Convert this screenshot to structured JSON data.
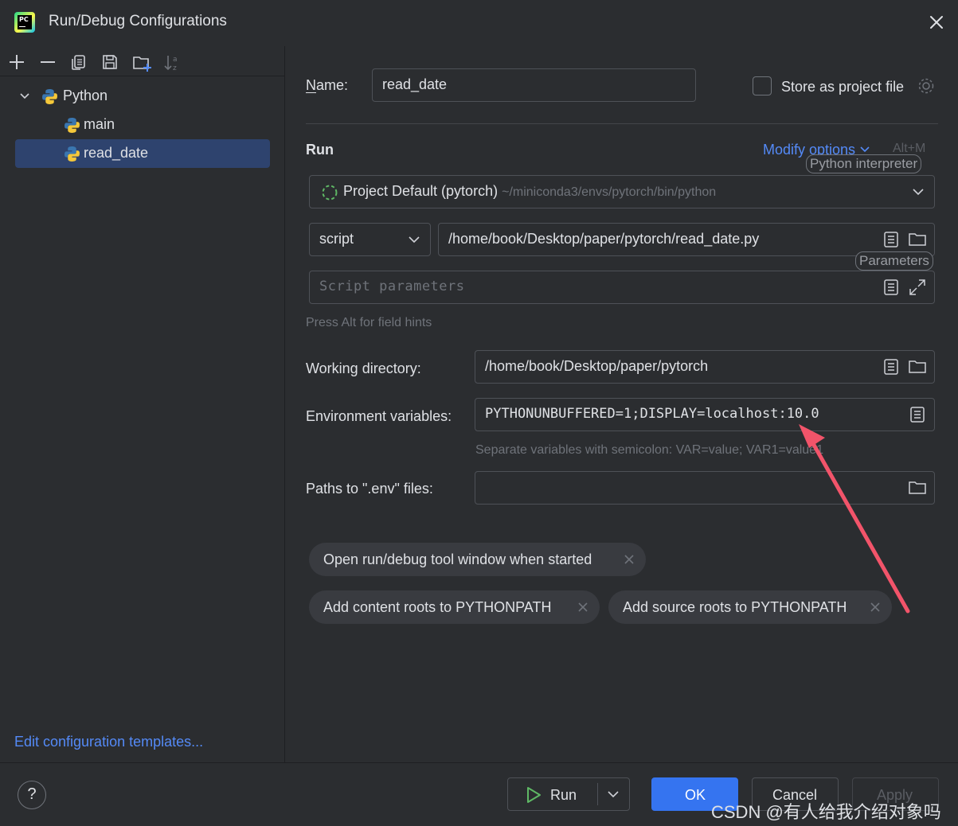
{
  "window": {
    "title": "Run/Debug Configurations"
  },
  "tree": {
    "group": "Python",
    "items": [
      {
        "label": "main"
      },
      {
        "label": "read_date",
        "selected": true
      }
    ]
  },
  "left_footer": {
    "edit_templates": "Edit configuration templates..."
  },
  "form": {
    "name_label": "Name:",
    "name_value": "read_date",
    "store_label": "Store as project file",
    "store_checked": false,
    "run_heading": "Run",
    "modify_options": "Modify options",
    "modify_shortcut": "Alt+M",
    "interpreter_tooltip": "Python interpreter",
    "interpreter_name": "Project Default (pytorch)",
    "interpreter_path": "~/miniconda3/envs/pytorch/bin/python",
    "script_type": "script",
    "script_path": "/home/book/Desktop/paper/pytorch/read_date.py",
    "parameters_tooltip": "Parameters",
    "script_params_placeholder": "Script parameters",
    "field_hints": "Press Alt for field hints",
    "workdir_label": "Working directory:",
    "workdir_value": "/home/book/Desktop/paper/pytorch",
    "env_label": "Environment variables:",
    "env_value": "PYTHONUNBUFFERED=1;DISPLAY=localhost:10.0",
    "env_hint": "Separate variables with semicolon: VAR=value; VAR1=value1",
    "dotenv_label": "Paths to \".env\" files:",
    "dotenv_value": ""
  },
  "chips": [
    {
      "label": "Open run/debug tool window when started"
    },
    {
      "label": "Add content roots to PYTHONPATH"
    },
    {
      "label": "Add source roots to PYTHONPATH"
    }
  ],
  "footer": {
    "help": "?",
    "run": "Run",
    "ok": "OK",
    "cancel": "Cancel",
    "apply": "Apply"
  },
  "watermark": "CSDN @有人给我介绍对象吗",
  "colors": {
    "background": "#2b2d30",
    "selection": "#2e436e",
    "link": "#548af7",
    "primary_button": "#3574f0",
    "annotation_arrow": "#f2546a"
  },
  "icons": {
    "toolbar": [
      "add-icon",
      "remove-icon",
      "copy-icon",
      "save-icon",
      "new-folder-icon",
      "sort-icon"
    ],
    "field": [
      "file-list-icon",
      "folder-icon",
      "expand-icon",
      "chevron-down-icon",
      "loading-icon",
      "gear-icon",
      "close-icon",
      "run-triangle-icon"
    ]
  }
}
